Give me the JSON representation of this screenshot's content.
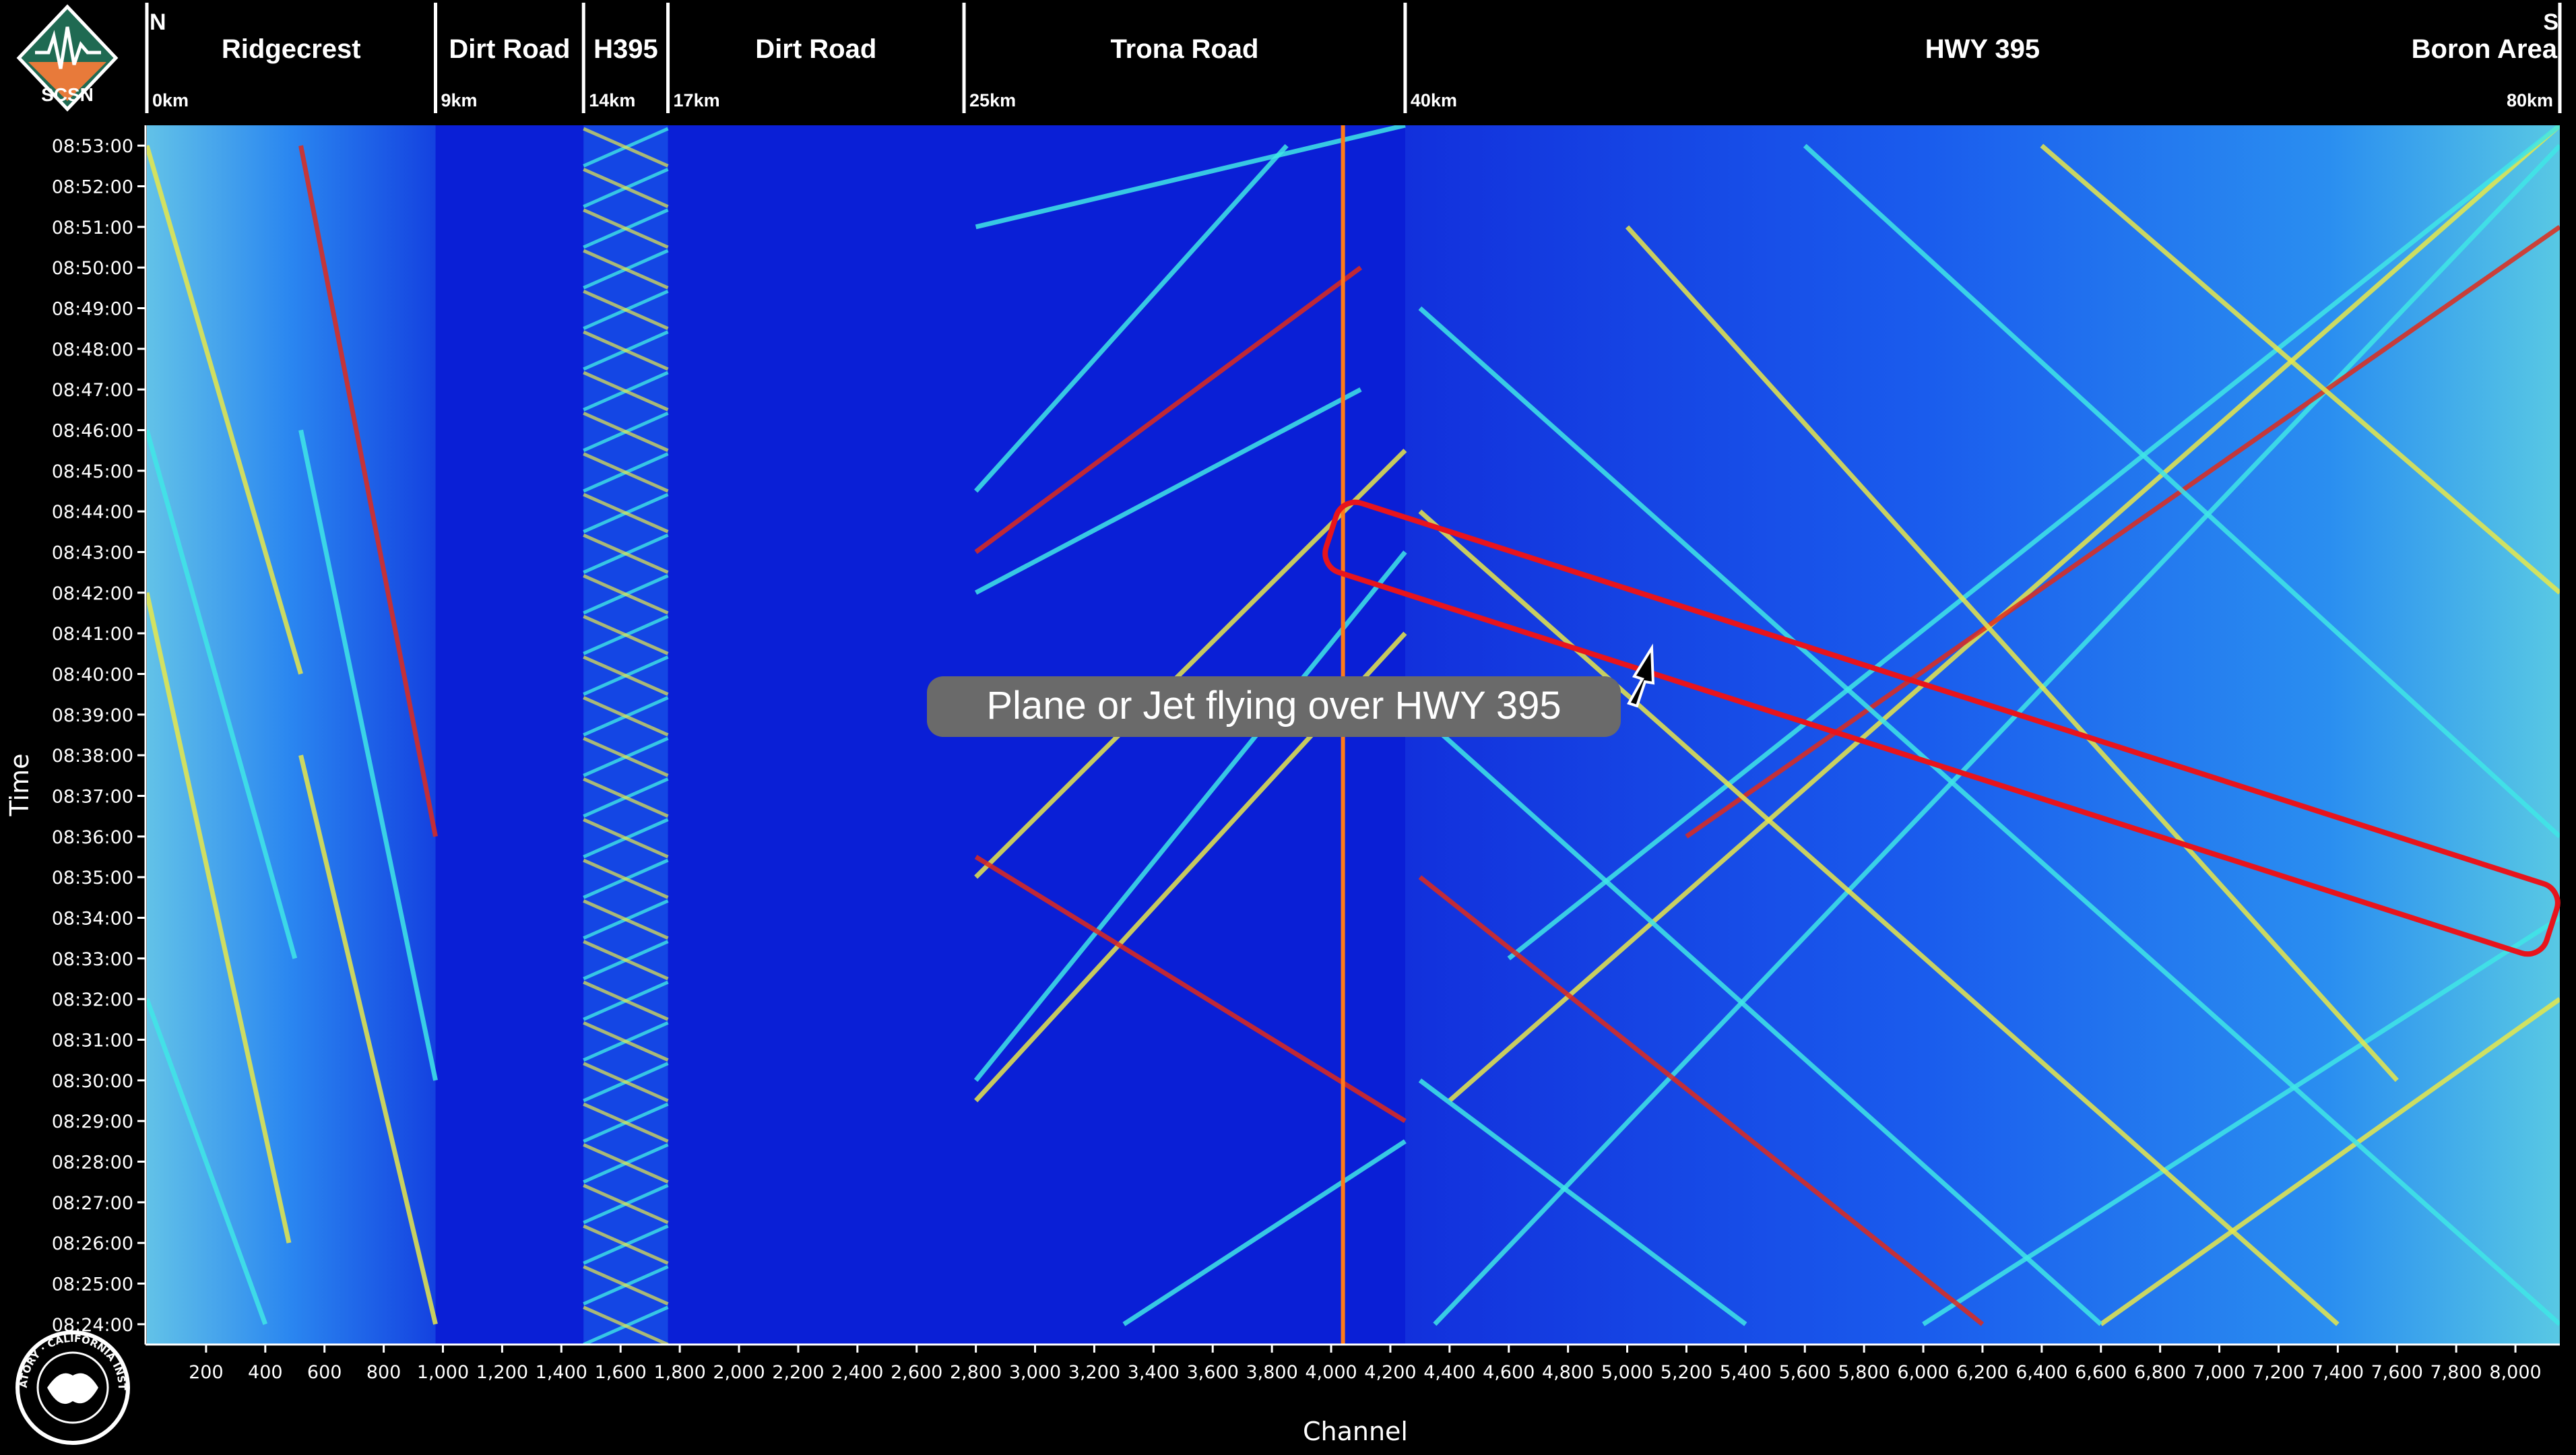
{
  "logo": {
    "text": "SCSN"
  },
  "seal": {
    "text": "SEISMOLOGICAL LABORATORY · CALIFORNIA INSTITUTE OF TECHNOLOGY"
  },
  "header": {
    "north": "N",
    "south": "S",
    "segments": [
      {
        "name": "Ridgecrest",
        "start_channel": 0,
        "end_channel": 975,
        "km": "0km"
      },
      {
        "name": "Dirt Road",
        "start_channel": 975,
        "end_channel": 1475,
        "km": "9km"
      },
      {
        "name": "H395",
        "start_channel": 1475,
        "end_channel": 1760,
        "km": "14km"
      },
      {
        "name": "Dirt Road",
        "start_channel": 1760,
        "end_channel": 2760,
        "km": "17km"
      },
      {
        "name": "Trona Road",
        "start_channel": 2760,
        "end_channel": 4250,
        "km": "25km"
      },
      {
        "name": "HWY 395",
        "start_channel": 4250,
        "end_channel": 8150,
        "km": "40km"
      }
    ],
    "end_label": "Boron Area",
    "end_km": "80km"
  },
  "callout": {
    "text": "Plane or Jet flying over HWY 395"
  },
  "colors": {
    "background": "#000000",
    "field": "#0a1fd6",
    "band": "#1a6ef0",
    "trace_cyan": "#3fe6e6",
    "trace_yellow": "#e8e84a",
    "trace_red": "#e02a1a",
    "highlight_box": "#e8141c",
    "callout_fill": "#6a6a6a"
  },
  "chart_data": {
    "type": "heatmap",
    "xlabel": "Channel",
    "ylabel": "Time",
    "xlim": [
      0,
      8150
    ],
    "ylim": [
      "08:23:30",
      "08:53:30"
    ],
    "x_ticks": [
      200,
      400,
      600,
      800,
      1000,
      1200,
      1400,
      1600,
      1800,
      2000,
      2200,
      2400,
      2600,
      2800,
      3000,
      3200,
      3400,
      3600,
      3800,
      4000,
      4200,
      4400,
      4600,
      4800,
      5000,
      5200,
      5400,
      5600,
      5800,
      6000,
      6200,
      6400,
      6600,
      6800,
      7000,
      7200,
      7400,
      7600,
      7800,
      8000
    ],
    "x_tick_labels": [
      "200",
      "400",
      "600",
      "800",
      "1,000",
      "1,200",
      "1,400",
      "1,600",
      "1,800",
      "2,000",
      "2,200",
      "2,400",
      "2,600",
      "2,800",
      "3,000",
      "3,200",
      "3,400",
      "3,600",
      "3,800",
      "4,000",
      "4,200",
      "4,400",
      "4,600",
      "4,800",
      "5,000",
      "5,200",
      "5,400",
      "5,600",
      "5,800",
      "6,000",
      "6,200",
      "6,400",
      "6,600",
      "6,800",
      "7,000",
      "7,200",
      "7,400",
      "7,600",
      "7,800",
      "8,000"
    ],
    "y_ticks": [
      "08:24:00",
      "08:25:00",
      "08:26:00",
      "08:27:00",
      "08:28:00",
      "08:29:00",
      "08:30:00",
      "08:31:00",
      "08:32:00",
      "08:33:00",
      "08:34:00",
      "08:35:00",
      "08:36:00",
      "08:37:00",
      "08:38:00",
      "08:39:00",
      "08:40:00",
      "08:41:00",
      "08:42:00",
      "08:43:00",
      "08:44:00",
      "08:45:00",
      "08:46:00",
      "08:47:00",
      "08:48:00",
      "08:49:00",
      "08:50:00",
      "08:51:00",
      "08:52:00",
      "08:53:00"
    ],
    "grid": false,
    "colormap": [
      "#0a1fd6",
      "#1a6ef0",
      "#3fe6e6",
      "#e8e84a",
      "#e02a1a"
    ],
    "bright_channels": [
      4040
    ],
    "highlight_region": {
      "start": {
        "channel": 4000,
        "time": "08:43:30"
      },
      "end": {
        "channel": 8150,
        "time": "08:33:50"
      }
    },
    "traces": [
      {
        "x": [
          4350,
          8150
        ],
        "t": [
          "08:24:00",
          "08:53:00"
        ]
      },
      {
        "x": [
          4400,
          8150
        ],
        "t": [
          "08:29:30",
          "08:53:30"
        ]
      },
      {
        "x": [
          4600,
          8150
        ],
        "t": [
          "08:33:00",
          "08:53:30"
        ]
      },
      {
        "x": [
          5200,
          8150
        ],
        "t": [
          "08:36:00",
          "08:51:00"
        ]
      },
      {
        "x": [
          6000,
          8150
        ],
        "t": [
          "08:24:00",
          "08:34:00"
        ]
      },
      {
        "x": [
          6600,
          8150
        ],
        "t": [
          "08:24:00",
          "08:32:00"
        ]
      },
      {
        "x": [
          4300,
          8150
        ],
        "t": [
          "08:49:00",
          "08:24:00"
        ]
      },
      {
        "x": [
          4300,
          7400
        ],
        "t": [
          "08:44:00",
          "08:24:00"
        ]
      },
      {
        "x": [
          4300,
          6600
        ],
        "t": [
          "08:39:00",
          "08:24:00"
        ]
      },
      {
        "x": [
          4300,
          6200
        ],
        "t": [
          "08:35:00",
          "08:24:00"
        ]
      },
      {
        "x": [
          4300,
          5400
        ],
        "t": [
          "08:30:00",
          "08:24:00"
        ]
      },
      {
        "x": [
          5000,
          7600
        ],
        "t": [
          "08:51:00",
          "08:30:00"
        ]
      },
      {
        "x": [
          5600,
          8150
        ],
        "t": [
          "08:53:00",
          "08:36:00"
        ]
      },
      {
        "x": [
          6400,
          8150
        ],
        "t": [
          "08:53:00",
          "08:42:00"
        ]
      },
      {
        "x": [
          2800,
          3850
        ],
        "t": [
          "08:44:30",
          "08:53:00"
        ]
      },
      {
        "x": [
          2800,
          4100
        ],
        "t": [
          "08:43:00",
          "08:50:00"
        ]
      },
      {
        "x": [
          2800,
          4100
        ],
        "t": [
          "08:42:00",
          "08:47:00"
        ]
      },
      {
        "x": [
          2800,
          4250
        ],
        "t": [
          "08:35:00",
          "08:45:30"
        ]
      },
      {
        "x": [
          2800,
          4250
        ],
        "t": [
          "08:30:00",
          "08:43:00"
        ]
      },
      {
        "x": [
          2800,
          4250
        ],
        "t": [
          "08:29:30",
          "08:41:00"
        ]
      },
      {
        "x": [
          2800,
          4250
        ],
        "t": [
          "08:51:00",
          "08:53:30"
        ]
      },
      {
        "x": [
          2800,
          4250
        ],
        "t": [
          "08:35:30",
          "08:29:00"
        ]
      },
      {
        "x": [
          3300,
          4250
        ],
        "t": [
          "08:24:00",
          "08:28:30"
        ]
      },
      {
        "x": [
          0,
          520
        ],
        "t": [
          "08:53:00",
          "08:40:00"
        ]
      },
      {
        "x": [
          0,
          500
        ],
        "t": [
          "08:46:00",
          "08:33:00"
        ]
      },
      {
        "x": [
          0,
          480
        ],
        "t": [
          "08:42:00",
          "08:26:00"
        ]
      },
      {
        "x": [
          0,
          400
        ],
        "t": [
          "08:32:00",
          "08:24:00"
        ]
      },
      {
        "x": [
          520,
          975
        ],
        "t": [
          "08:53:00",
          "08:36:00"
        ]
      },
      {
        "x": [
          520,
          975
        ],
        "t": [
          "08:46:00",
          "08:30:00"
        ]
      },
      {
        "x": [
          520,
          975
        ],
        "t": [
          "08:38:00",
          "08:24:00"
        ]
      }
    ]
  }
}
